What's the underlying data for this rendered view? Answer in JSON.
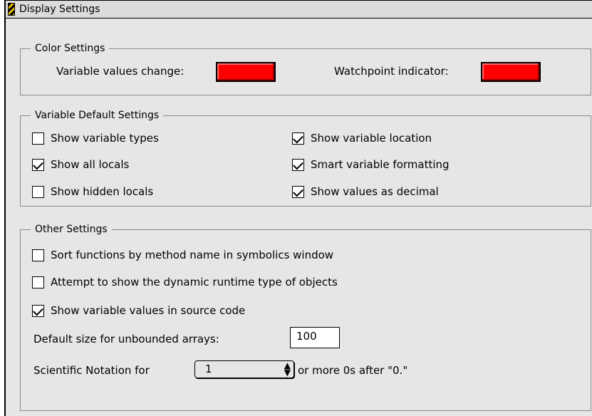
{
  "window": {
    "title": "Display Settings"
  },
  "color_settings": {
    "title": "Color Settings",
    "variable_values_change_label": "Variable values change:",
    "variable_values_change_color": "#ff0000",
    "watchpoint_indicator_label": "Watchpoint indicator:",
    "watchpoint_indicator_color": "#ff0000"
  },
  "variable_defaults": {
    "title": "Variable Default Settings",
    "show_variable_types": {
      "label": "Show variable types",
      "checked": false
    },
    "show_all_locals": {
      "label": "Show all locals",
      "checked": true
    },
    "show_hidden_locals": {
      "label": "Show hidden locals",
      "checked": false
    },
    "show_variable_location": {
      "label": "Show variable location",
      "checked": true
    },
    "smart_variable_formatting": {
      "label": "Smart variable formatting",
      "checked": true
    },
    "show_values_as_decimal": {
      "label": "Show values as decimal",
      "checked": true
    }
  },
  "other_settings": {
    "title": "Other Settings",
    "sort_functions": {
      "label": "Sort functions by method name in symbolics window",
      "checked": false
    },
    "dynamic_runtime_type": {
      "label": "Attempt to show the dynamic runtime type of objects",
      "checked": false
    },
    "show_values_in_source": {
      "label": "Show variable values in source code",
      "checked": true
    },
    "unbounded_arrays_label": "Default size for unbounded arrays:",
    "unbounded_arrays_value": "100",
    "scientific_notation_label": "Scientific Notation for",
    "scientific_notation_value": "1",
    "scientific_notation_suffix": "or more 0s after \"0.\""
  }
}
